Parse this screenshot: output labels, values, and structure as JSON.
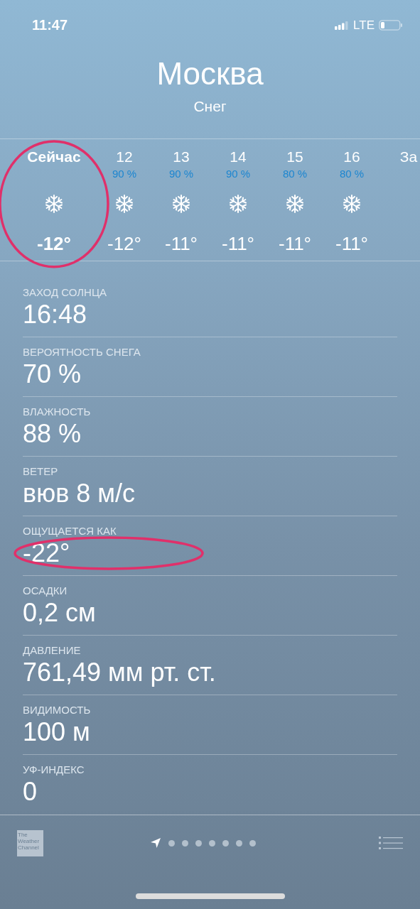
{
  "status_bar": {
    "time": "11:47",
    "network": "LTE"
  },
  "location": {
    "city": "Москва",
    "condition": "Снег"
  },
  "hourly": [
    {
      "time": "Сейчас",
      "temp": "-12°",
      "now": true,
      "circled": true
    },
    {
      "time": "12",
      "chance": "90 %",
      "temp": "-12°",
      "now": false,
      "circled": false
    },
    {
      "time": "13",
      "chance": "90 %",
      "temp": "-11°",
      "now": false,
      "circled": false
    },
    {
      "time": "14",
      "chance": "90 %",
      "temp": "-11°",
      "now": false,
      "circled": false
    },
    {
      "time": "15",
      "chance": "80 %",
      "temp": "-11°",
      "now": false,
      "circled": false
    },
    {
      "time": "16",
      "chance": "80 %",
      "temp": "-11°",
      "now": false,
      "circled": false
    },
    {
      "time": "За",
      "now": false,
      "circled": false
    }
  ],
  "details": [
    {
      "label": "ЗАХОД СОЛНЦА",
      "value": "16:48",
      "circled": false
    },
    {
      "label": "ВЕРОЯТНОСТЬ СНЕГА",
      "value": "70 %",
      "circled": false
    },
    {
      "label": "ВЛАЖНОСТЬ",
      "value": "88 %",
      "circled": false
    },
    {
      "label": "ВЕТЕР",
      "value": "вюв 8 м/с",
      "circled": false
    },
    {
      "label": "ОЩУЩАЕТСЯ КАК",
      "value": "-22°",
      "circled": true
    },
    {
      "label": "ОСАДКИ",
      "value": "0,2 см",
      "circled": false
    },
    {
      "label": "ДАВЛЕНИЕ",
      "value": "761,49 мм рт. ст.",
      "circled": false
    },
    {
      "label": "ВИДИМОСТЬ",
      "value": "100 м",
      "circled": false
    },
    {
      "label": "УФ-ИНДЕКС",
      "value": "0",
      "circled": false
    }
  ],
  "toolbar": {
    "logo": "The Weather Channel",
    "pages": [
      {
        "kind": "location",
        "selected": true
      },
      {
        "kind": "dot",
        "selected": false
      },
      {
        "kind": "dot",
        "selected": false
      },
      {
        "kind": "dot",
        "selected": false
      },
      {
        "kind": "dot",
        "selected": false
      },
      {
        "kind": "dot",
        "selected": false
      },
      {
        "kind": "dot",
        "selected": false
      },
      {
        "kind": "dot",
        "selected": false
      }
    ]
  }
}
